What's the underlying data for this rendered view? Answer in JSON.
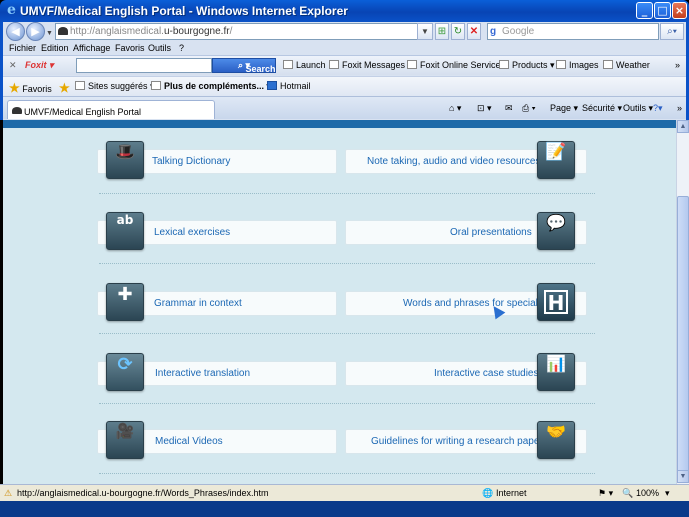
{
  "window": {
    "title": "UMVF/Medical English Portal - Windows Internet Explorer",
    "minimize_icon": "minimize-icon",
    "maximize_icon": "maximize-icon",
    "close_icon": "close-icon"
  },
  "address": {
    "url_prefix": "http://anglaismedical.",
    "url_domain": "u-bourgogne.fr",
    "url_suffix": "/",
    "search_placeholder": "Google"
  },
  "menu": {
    "items": [
      "Fichier",
      "Edition",
      "Affichage",
      "Favoris",
      "Outils",
      "?"
    ]
  },
  "foxit_toolbar": {
    "brand": "Foxit",
    "search_button": "Search",
    "launch": "Launch",
    "messages": "Foxit Messages",
    "online_services": "Foxit Online Services",
    "products": "Products",
    "images": "Images",
    "weather": "Weather"
  },
  "favorites_bar": {
    "favoris": "Favoris",
    "suggested_sites": "Sites suggérés",
    "more_addons": "Plus de compléments...",
    "hotmail": "Hotmail"
  },
  "tab": {
    "label": "UMVF/Medical English Portal"
  },
  "command_bar": {
    "page": "Page",
    "security": "Sécurité",
    "tools": "Outils"
  },
  "items": {
    "left": [
      {
        "label": "Talking Dictionary",
        "icon": "bowler-hat-icon"
      },
      {
        "label": "Lexical exercises",
        "icon": "speech-bubble-ab-icon"
      },
      {
        "label": "Grammar in context",
        "icon": "puzzle-pieces-icon"
      },
      {
        "label": "Interactive translation",
        "icon": "refresh-arrows-icon"
      },
      {
        "label": "Medical Videos",
        "icon": "video-camera-icon"
      }
    ],
    "right": [
      {
        "label": "Note taking, audio and video resources",
        "icon": "notepad-icon"
      },
      {
        "label": "Oral presentations",
        "icon": "speech-bubbles-icon"
      },
      {
        "label": "Words and phrases for specialists",
        "icon": "hospital-h-icon",
        "glyph": "H"
      },
      {
        "label": "Interactive case studies",
        "icon": "presentation-board-icon"
      },
      {
        "label": "Guidelines for writing a research paper",
        "icon": "handshake-icon"
      }
    ]
  },
  "status_bar": {
    "url": "http://anglaismedical.u-bourgogne.fr/Words_Phrases/index.htm",
    "zone": "Internet",
    "zoom": "100%"
  }
}
